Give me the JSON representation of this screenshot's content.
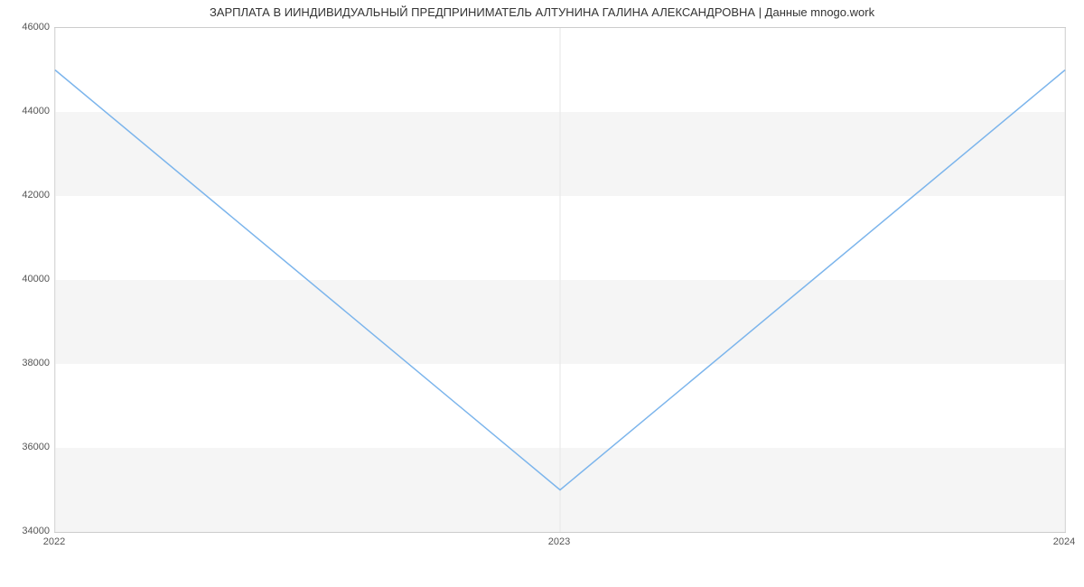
{
  "chart_data": {
    "type": "line",
    "title": "ЗАРПЛАТА В ИИНДИВИДУАЛЬНЫЙ ПРЕДПРИНИМАТЕЛЬ АЛТУНИНА ГАЛИНА АЛЕКСАНДРОВНА | Данные mnogo.work",
    "x": [
      "2022",
      "2023",
      "2024"
    ],
    "values": [
      45000,
      35000,
      45000
    ],
    "ylim": [
      34000,
      46000
    ],
    "y_ticks": [
      34000,
      36000,
      38000,
      40000,
      42000,
      44000,
      46000
    ],
    "x_tick_labels": [
      "2022",
      "2023",
      "2024"
    ],
    "series_color": "#7cb5ec",
    "band_color": "#f5f5f5"
  }
}
